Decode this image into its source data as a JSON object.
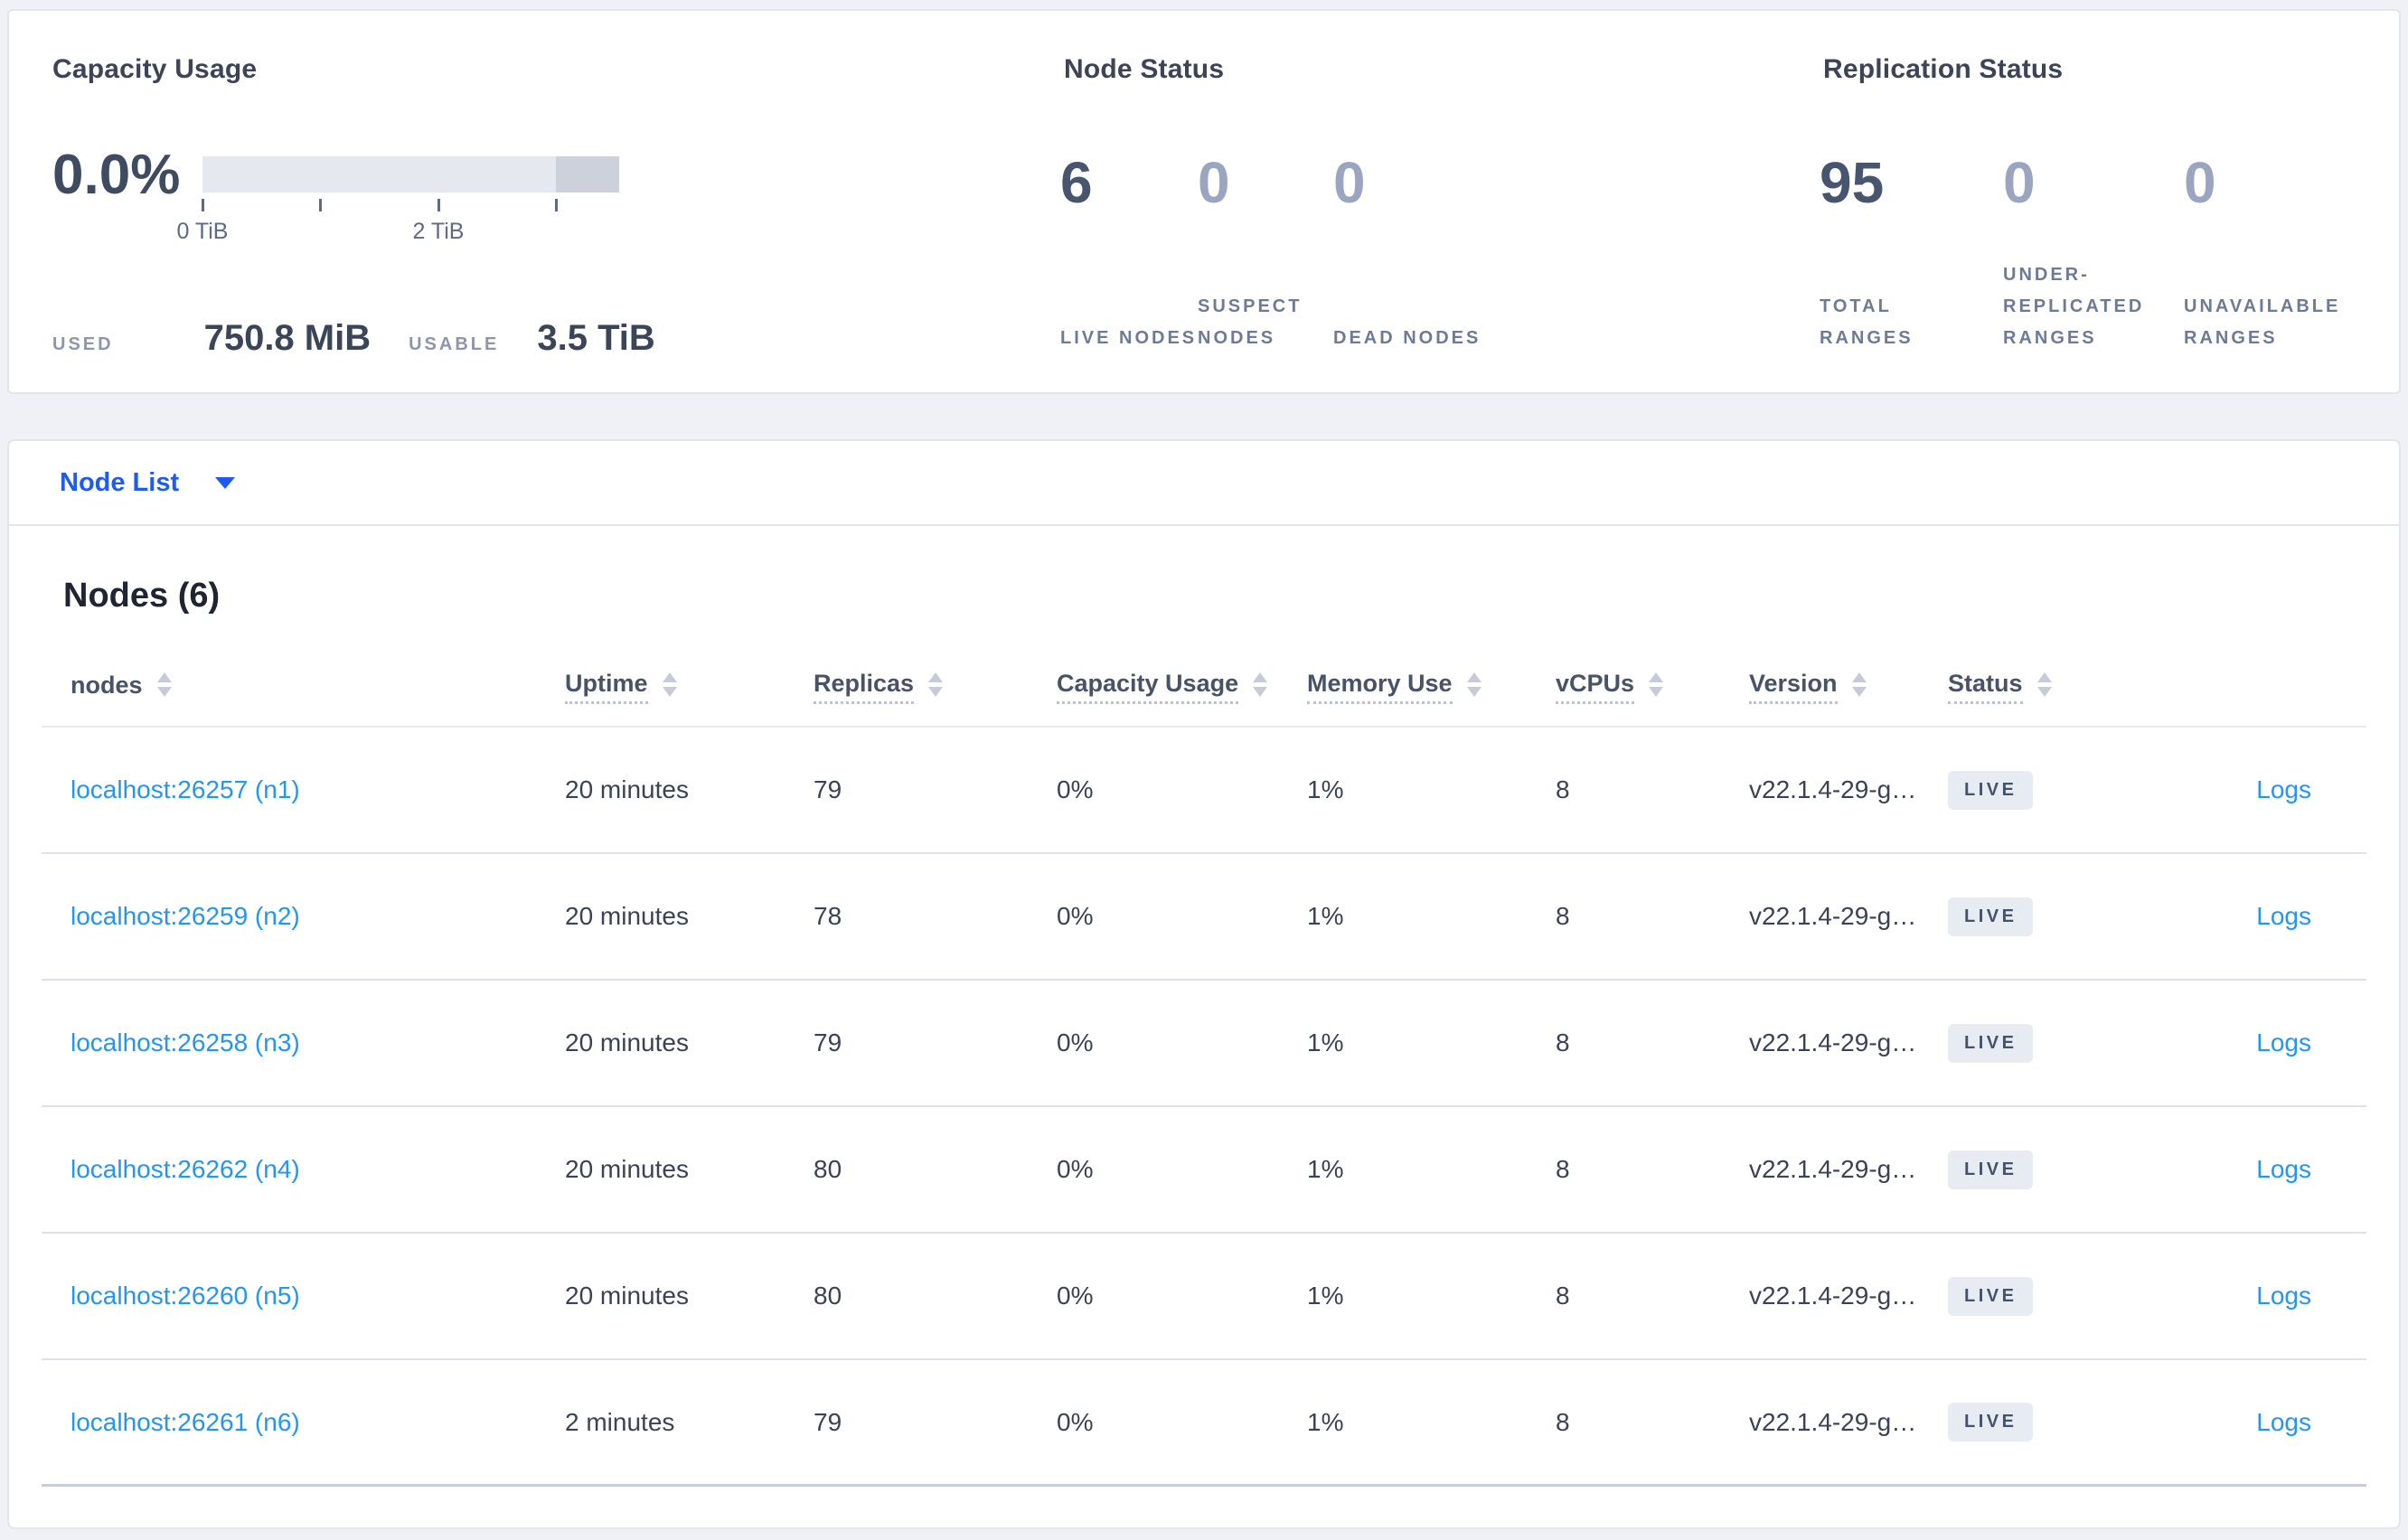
{
  "colors": {
    "link_blue": "#2196f3",
    "accent_blue": "#1d5bf2",
    "dark_text": "#3a4457",
    "muted_label": "#6e7b97",
    "faded_number": "#9aa5bf",
    "badge_bg": "#e7ebf2",
    "badge_text": "#44536b",
    "bar_light": "#e6e8ef",
    "bar_dark": "#ccd1dc",
    "panel_bg": "#ffffff",
    "page_bg": "#f0f1f6"
  },
  "summary": {
    "capacity": {
      "title": "Capacity Usage",
      "percent": "0.0%",
      "tick_label_0": "0 TiB",
      "tick_label_2": "2 TiB",
      "used_label": "USED",
      "used_value": "750.8 MiB",
      "usable_label": "USABLE",
      "usable_value": "3.5 TiB"
    },
    "node_status": {
      "title": "Node Status",
      "items": [
        {
          "value": "6",
          "label": "LIVE NODES"
        },
        {
          "value": "0",
          "label": "SUSPECT NODES"
        },
        {
          "value": "0",
          "label": "DEAD NODES"
        }
      ]
    },
    "replication": {
      "title": "Replication Status",
      "items": [
        {
          "value": "95",
          "label": "TOTAL RANGES"
        },
        {
          "value": "0",
          "label": "UNDER-REPLICATED RANGES"
        },
        {
          "value": "0",
          "label": "UNAVAILABLE RANGES"
        }
      ]
    }
  },
  "node_list_bar": {
    "label": "Node List"
  },
  "nodes": {
    "heading": "Nodes (6)",
    "headers": {
      "nodes": "nodes",
      "uptime": "Uptime",
      "replicas": "Replicas",
      "capacity": "Capacity Usage",
      "memory": "Memory Use",
      "vcpus": "vCPUs",
      "version": "Version",
      "status": "Status"
    },
    "rows": [
      {
        "node": "localhost:26257 (n1)",
        "uptime": "20 minutes",
        "replicas": "79",
        "capacity": "0%",
        "memory": "1%",
        "vcpus": "8",
        "version": "v22.1.4-29-g…",
        "status": "LIVE",
        "logs": "Logs"
      },
      {
        "node": "localhost:26259 (n2)",
        "uptime": "20 minutes",
        "replicas": "78",
        "capacity": "0%",
        "memory": "1%",
        "vcpus": "8",
        "version": "v22.1.4-29-g…",
        "status": "LIVE",
        "logs": "Logs"
      },
      {
        "node": "localhost:26258 (n3)",
        "uptime": "20 minutes",
        "replicas": "79",
        "capacity": "0%",
        "memory": "1%",
        "vcpus": "8",
        "version": "v22.1.4-29-g…",
        "status": "LIVE",
        "logs": "Logs"
      },
      {
        "node": "localhost:26262 (n4)",
        "uptime": "20 minutes",
        "replicas": "80",
        "capacity": "0%",
        "memory": "1%",
        "vcpus": "8",
        "version": "v22.1.4-29-g…",
        "status": "LIVE",
        "logs": "Logs"
      },
      {
        "node": "localhost:26260 (n5)",
        "uptime": "20 minutes",
        "replicas": "80",
        "capacity": "0%",
        "memory": "1%",
        "vcpus": "8",
        "version": "v22.1.4-29-g…",
        "status": "LIVE",
        "logs": "Logs"
      },
      {
        "node": "localhost:26261 (n6)",
        "uptime": "2 minutes",
        "replicas": "79",
        "capacity": "0%",
        "memory": "1%",
        "vcpus": "8",
        "version": "v22.1.4-29-g…",
        "status": "LIVE",
        "logs": "Logs"
      }
    ]
  }
}
